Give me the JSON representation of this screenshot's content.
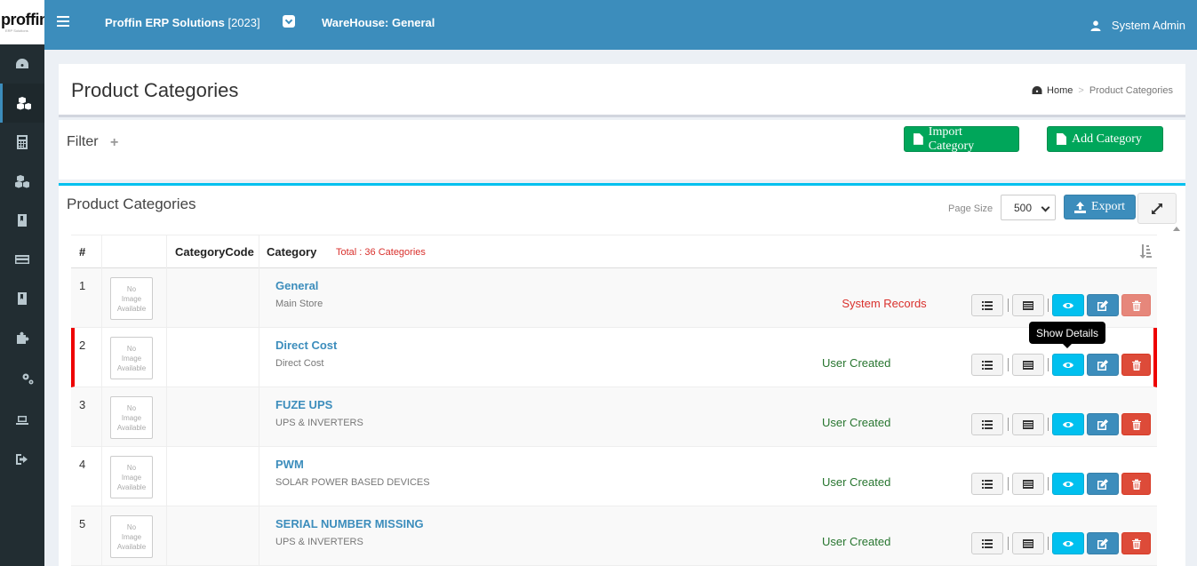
{
  "logo": {
    "text": "proffin",
    "tagline": "ERP Solutions"
  },
  "header": {
    "app_name": "Proffin ERP Solutions",
    "year": "[2023]",
    "warehouse": "WareHouse: General",
    "user": "System Admin"
  },
  "sidebar": {
    "icons": [
      "dashboard-icon",
      "cubes-icon",
      "calculator-icon",
      "cubes-icon",
      "book-icon",
      "credit-card-icon",
      "book-icon",
      "puzzle-icon",
      "cogs-icon",
      "laptop-icon",
      "sign-out-icon"
    ],
    "active_index": 1
  },
  "page": {
    "title": "Product Categories",
    "breadcrumb": {
      "home": "Home",
      "current": "Product Categories"
    }
  },
  "filter": {
    "label": "Filter",
    "plus": "+",
    "import_label": "Import Category",
    "add_label": "Add Category"
  },
  "list": {
    "title": "Product Categories",
    "page_size_label": "Page Size",
    "page_size": "500",
    "export_label": "Export",
    "columns": {
      "num": "#",
      "code": "CategoryCode",
      "category": "Category"
    },
    "total": "Total : 36 Categories",
    "no_image": [
      "No",
      "Image",
      "Available"
    ],
    "tooltip": "Show Details",
    "rows": [
      {
        "num": "1",
        "code": "",
        "name": "General",
        "desc": "Main Store",
        "status": "System Records",
        "status_type": "sys",
        "delete_disabled": true
      },
      {
        "num": "2",
        "code": "",
        "name": "Direct Cost",
        "desc": "Direct Cost",
        "status": "User Created",
        "status_type": "user",
        "delete_disabled": false,
        "highlighted": true
      },
      {
        "num": "3",
        "code": "",
        "name": "FUZE UPS",
        "desc": "UPS & INVERTERS",
        "status": "User Created",
        "status_type": "user",
        "delete_disabled": false
      },
      {
        "num": "4",
        "code": "",
        "name": "PWM",
        "desc": "SOLAR POWER BASED DEVICES",
        "status": "User Created",
        "status_type": "user",
        "delete_disabled": false
      },
      {
        "num": "5",
        "code": "",
        "name": "SERIAL NUMBER MISSING",
        "desc": "UPS & INVERTERS",
        "status": "User Created",
        "status_type": "user",
        "delete_disabled": false
      }
    ]
  },
  "colors": {
    "header": "#3c8dbc",
    "sidebar": "#222d32",
    "success": "#00a65a",
    "info": "#00c0ef",
    "danger": "#dd4b39",
    "highlight": "#ee0000"
  }
}
